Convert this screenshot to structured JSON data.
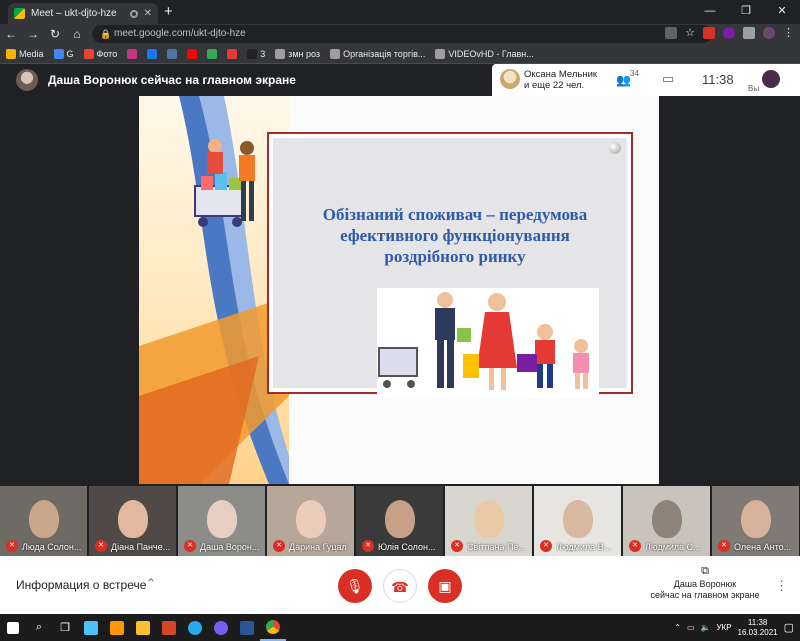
{
  "browser": {
    "tab_title": "Meet – ukt-djto-hze",
    "tab_close": "✕",
    "new_tab": "+",
    "url": "meet.google.com/ukt-djto-hze",
    "window_minimize": "—",
    "window_restore": "❐",
    "window_close": "✕"
  },
  "bookmarks": [
    {
      "label": "Media",
      "color": "#f4b400"
    },
    {
      "label": "G",
      "color": "#4285f4"
    },
    {
      "label": "Фото",
      "color": "#ea4335"
    },
    {
      "label": "",
      "color": "#c13584"
    },
    {
      "label": "",
      "color": "#1877f2"
    },
    {
      "label": "",
      "color": "#4c75a3"
    },
    {
      "label": "",
      "color": "#ff0000"
    },
    {
      "label": "",
      "color": "#34a853"
    },
    {
      "label": "",
      "color": "#e53935"
    },
    {
      "label": "3",
      "color": "#222222"
    },
    {
      "label": "змн роз",
      "color": "#9e9e9e"
    },
    {
      "label": "Організація торгів...",
      "color": "#9e9e9e"
    },
    {
      "label": "VIDEOvHD - Главн...",
      "color": "#9e9e9e"
    }
  ],
  "meet": {
    "presenter_banner": "Даша Воронюк сейчас на главном экране",
    "speaker_name": "Оксана Мельник",
    "speaker_others": "и еще 22 чел.",
    "participant_count": "34",
    "time": "11:38",
    "self_label": "Вы"
  },
  "slide": {
    "title": "Обізнаний споживач – передумова ефективного функціонування роздрібного ринку"
  },
  "participants": [
    {
      "name": "Люда Солон...",
      "bg": "#6e6a64",
      "face": "#c9a58a"
    },
    {
      "name": "Діана Панче...",
      "bg": "#4f4a48",
      "face": "#e2b9a0"
    },
    {
      "name": "Даша Ворон...",
      "bg": "#8c8c88",
      "face": "#e6cfc2"
    },
    {
      "name": "Дарина Гуцал",
      "bg": "#b7a79a",
      "face": "#e9cdb8"
    },
    {
      "name": "Юлія Солон...",
      "bg": "#3b3a3a",
      "face": "#c69f86"
    },
    {
      "name": "Світлана Пе...",
      "bg": "#d9d6cf",
      "face": "#eac9a6"
    },
    {
      "name": "Людмила В...",
      "bg": "#e7e5e1",
      "face": "#d8b89e"
    },
    {
      "name": "Людмила С...",
      "bg": "#c9c4bb",
      "face": "#8e8378"
    },
    {
      "name": "Олена Анто...",
      "bg": "#7f7a76",
      "face": "#d6b19c"
    }
  ],
  "controls": {
    "meeting_info": "Информация о встрече",
    "presenting_line1": "Даша Воронюк",
    "presenting_line2": "сейчас на главном экране"
  },
  "taskbar": {
    "lang": "УКР",
    "time": "11:38",
    "date": "16.03.2021"
  }
}
